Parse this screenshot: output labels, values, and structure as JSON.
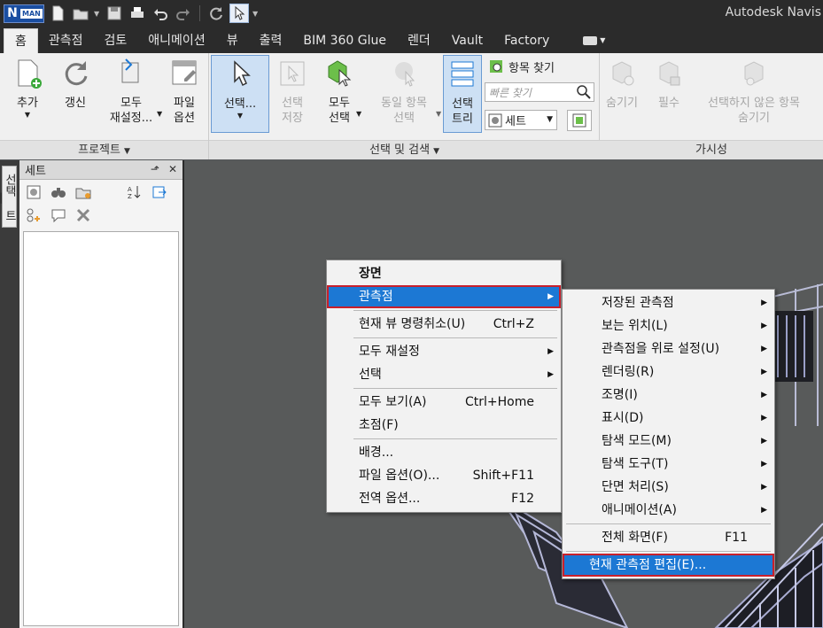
{
  "app": {
    "title": "Autodesk Navis",
    "logo_letter": "N",
    "logo_sub": "MAN"
  },
  "tabs": [
    "홈",
    "관측점",
    "검토",
    "애니메이션",
    "뷰",
    "출력",
    "BIM 360 Glue",
    "렌더",
    "Vault",
    "Factory"
  ],
  "ribbon": {
    "project": {
      "label": "프로젝트",
      "add": "추가",
      "refresh": "갱신",
      "reset_all_1": "모두",
      "reset_all_2": "재설정...",
      "file_opt_1": "파일",
      "file_opt_2": "옵션"
    },
    "select": {
      "label": "선택 및 검색",
      "select": "선택...",
      "save_sel_1": "선택",
      "save_sel_2": "저장",
      "select_all_1": "모두",
      "select_all_2": "선택",
      "same_1": "동일 항목",
      "same_2": "선택",
      "sel_tree_1": "선택",
      "sel_tree_2": "트리",
      "find_items": "항목 찾기",
      "quick_find_placeholder": "빠른 찾기",
      "sets": "세트"
    },
    "visibility": {
      "label": "가시성",
      "hide": "숨기기",
      "require": "필수",
      "hide_unselected_1": "선택하지 않은 항목",
      "hide_unselected_2": "숨기기"
    }
  },
  "side_strip": {
    "label": "선택 트리"
  },
  "sets_panel": {
    "title": "세트"
  },
  "context_menu": {
    "items": [
      {
        "label": "장면",
        "bold": true
      },
      {
        "label": "관측점",
        "submenu": true,
        "highlight": true
      },
      {
        "sep": true
      },
      {
        "label": "현재 뷰 명령취소(U)",
        "shortcut": "Ctrl+Z"
      },
      {
        "sep": true
      },
      {
        "label": "모두 재설정",
        "submenu": true
      },
      {
        "label": "선택",
        "submenu": true
      },
      {
        "sep": true
      },
      {
        "label": "모두 보기(A)",
        "shortcut": "Ctrl+Home"
      },
      {
        "label": "초점(F)"
      },
      {
        "sep": true
      },
      {
        "label": "배경..."
      },
      {
        "label": "파일 옵션(O)...",
        "shortcut": "Shift+F11"
      },
      {
        "label": "전역 옵션...",
        "shortcut": "F12"
      }
    ]
  },
  "submenu": {
    "items": [
      {
        "label": "저장된 관측점",
        "submenu": true
      },
      {
        "label": "보는 위치(L)",
        "submenu": true
      },
      {
        "label": "관측점을 위로 설정(U)",
        "submenu": true
      },
      {
        "label": "렌더링(R)",
        "submenu": true
      },
      {
        "label": "조명(I)",
        "submenu": true
      },
      {
        "label": "표시(D)",
        "submenu": true
      },
      {
        "label": "탐색 모드(M)",
        "submenu": true
      },
      {
        "label": "탐색 도구(T)",
        "submenu": true
      },
      {
        "label": "단면 처리(S)",
        "submenu": true
      },
      {
        "label": "애니메이션(A)",
        "submenu": true
      },
      {
        "sep": true
      },
      {
        "label": "전체 화면(F)",
        "shortcut": "F11"
      },
      {
        "sep": true
      },
      {
        "label": "현재 관측점 편집(E)...",
        "highlight": true
      }
    ]
  },
  "colors": {
    "highlight": "#1c78d4",
    "highlight_border": "#c8202c",
    "titlebar": "#2b2b2b",
    "ribbon": "#f0f0f0",
    "viewport": "#585a5a"
  }
}
